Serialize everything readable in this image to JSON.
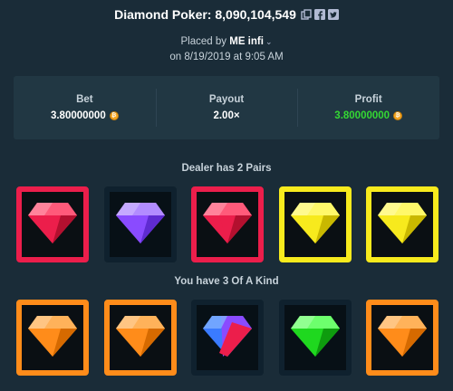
{
  "header": {
    "title": "Diamond Poker: 8,090,104,549",
    "icons": [
      "copy-icon",
      "facebook-icon",
      "twitter-icon"
    ]
  },
  "placed": {
    "prefix": "Placed by",
    "user": "ME infi",
    "date": "on 8/19/2019 at 9:05 AM"
  },
  "stats": {
    "bet_label": "Bet",
    "bet_value": "3.80000000",
    "payout_label": "Payout",
    "payout_value": "2.00×",
    "profit_label": "Profit",
    "profit_value": "3.80000000",
    "profit_color": "#34d833"
  },
  "dealer": {
    "title": "Dealer has 2 Pairs",
    "gems": [
      {
        "color": "red",
        "highlight": "red"
      },
      {
        "color": "purple",
        "highlight": "none"
      },
      {
        "color": "red",
        "highlight": "red"
      },
      {
        "color": "yellow",
        "highlight": "yellow"
      },
      {
        "color": "yellow",
        "highlight": "yellow"
      }
    ]
  },
  "player": {
    "title": "You have 3 Of A Kind",
    "gems": [
      {
        "color": "orange",
        "highlight": "orange"
      },
      {
        "color": "orange",
        "highlight": "orange"
      },
      {
        "color": "multi",
        "highlight": "none"
      },
      {
        "color": "green",
        "highlight": "none"
      },
      {
        "color": "orange",
        "highlight": "orange"
      }
    ]
  },
  "colors": {
    "background": "#1a2c38",
    "panel": "#213743",
    "red": "#ec1e4b",
    "yellow": "#f7ea1d",
    "orange": "#ff8c1a",
    "purple": "#8a4bff",
    "green": "#1fd81f"
  }
}
